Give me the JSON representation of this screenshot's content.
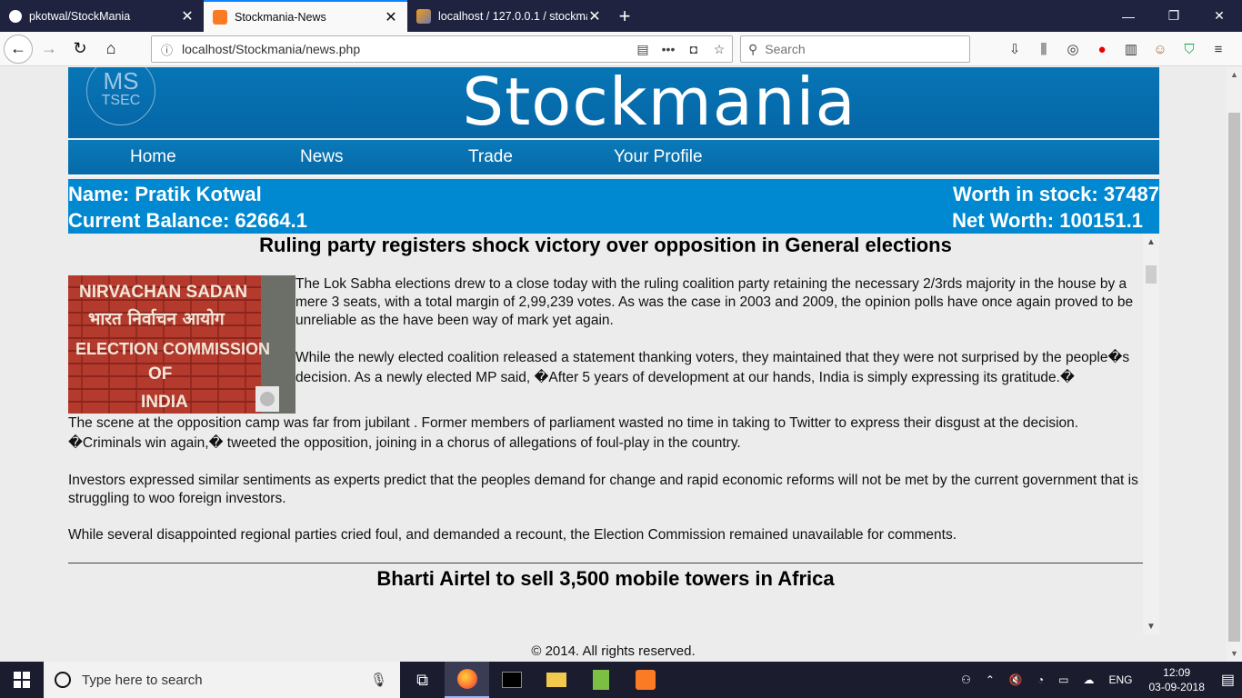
{
  "browser": {
    "tabs": [
      {
        "title": "pkotwal/StockMania",
        "active": false
      },
      {
        "title": "Stockmania-News",
        "active": true
      },
      {
        "title": "localhost / 127.0.0.1 / stockmai",
        "active": false
      }
    ],
    "new_tab": "+",
    "url": "localhost/Stockmania/news.php",
    "search_placeholder": "Search"
  },
  "site": {
    "logo_top": "MS",
    "logo_bottom": "TSEC",
    "title": "Stockmania",
    "menu": [
      "Home",
      "News",
      "Trade",
      "Your Profile"
    ]
  },
  "user": {
    "name_line": "Name: Pratik Kotwal",
    "balance_line": "Current Balance: 62664.1",
    "worth_line": "Worth in stock: 37487",
    "net_line": "Net Worth: 100151.1"
  },
  "news": {
    "article1": {
      "headline": "Ruling party registers shock victory over opposition in General elections",
      "image_caption_lines": [
        "NIRVACHAN SADAN",
        "भारत निर्वाचन आयोग",
        "ELECTION COMMISSION",
        "OF",
        "INDIA"
      ],
      "paragraphs": [
        "The Lok Sabha elections drew to a close today with the ruling coalition party retaining the necessary 2/3rds majority in the house by a mere 3 seats, with a total margin of 2,99,239 votes. As was the case in 2003 and 2009, the opinion polls have once again proved to be unreliable as the have been way of mark yet again.",
        "While the newly elected coalition released a statement thanking voters, they maintained that they were not surprised by the people�s decision. As a newly elected MP said, �After 5 years of development at our hands, India is simply expressing its gratitude.�",
        "The scene at the opposition camp was far from jubilant . Former members of parliament wasted no time in taking to Twitter to express their disgust at the decision. �Criminals win again,� tweeted the opposition, joining in a chorus of allegations of foul-play in the country.",
        "Investors expressed similar sentiments as experts predict that the peoples demand for change and rapid economic reforms will not be met by the current government that is struggling to woo foreign investors.",
        "While several disappointed regional parties cried foul, and demanded a recount, the Election Commission remained unavailable for comments."
      ]
    },
    "article2": {
      "headline": "Bharti Airtel to sell 3,500 mobile towers in Africa"
    }
  },
  "footer": "© 2014. All rights reserved.",
  "taskbar": {
    "search_placeholder": "Type here to search",
    "language": "ENG",
    "time": "12:09",
    "date": "03-09-2018"
  },
  "colors": {
    "header_blue": "#0670b0",
    "info_blue": "#0088d1",
    "tab_strip": "#202340"
  }
}
